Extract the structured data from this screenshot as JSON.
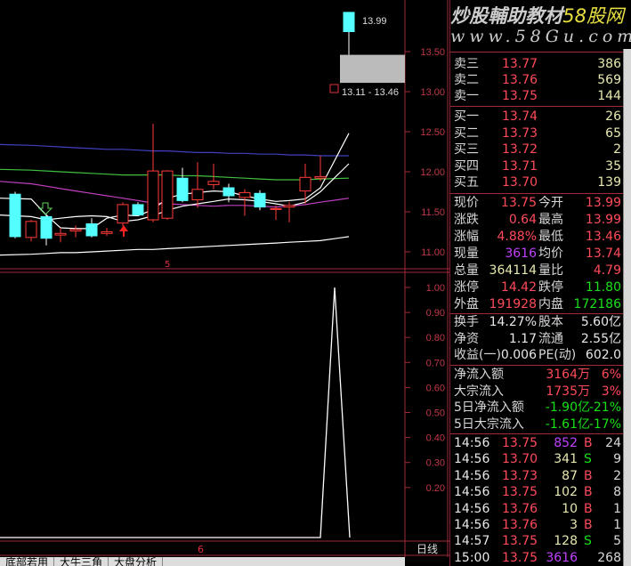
{
  "watermark": {
    "line1": "炒股輔助教材",
    "line1_brand": "58股网",
    "line2": "www.58Gu.com"
  },
  "main_chart": {
    "price_axis": [
      "13.50",
      "13.00",
      "12.50",
      "12.00",
      "11.50",
      "11.00"
    ],
    "price_axis_values": [
      13.5,
      13.0,
      12.5,
      12.0,
      11.5,
      11.0
    ],
    "last_price_label": "13.99",
    "range_label": "13.11 - 13.46",
    "range": [
      13.11,
      13.46
    ],
    "time_marker": "5",
    "colors": {
      "up": "#ff3a3a",
      "down": "#54ffff",
      "ma1": "#ffffff",
      "ma2": "#ffffff",
      "ma3": "#c040c0",
      "ma4": "#40c040",
      "ma5": "#4040c0",
      "ma6": "#ffffff"
    },
    "candles": [
      {
        "o": 11.72,
        "h": 11.75,
        "l": 11.17,
        "c": 11.19
      },
      {
        "o": 11.18,
        "h": 11.4,
        "l": 11.13,
        "c": 11.38
      },
      {
        "o": 11.44,
        "h": 11.48,
        "l": 11.08,
        "c": 11.17
      },
      {
        "o": 11.21,
        "h": 11.3,
        "l": 11.12,
        "c": 11.23
      },
      {
        "o": 11.26,
        "h": 11.33,
        "l": 11.18,
        "c": 11.28
      },
      {
        "o": 11.35,
        "h": 11.42,
        "l": 11.18,
        "c": 11.2
      },
      {
        "o": 11.23,
        "h": 11.3,
        "l": 11.2,
        "c": 11.25
      },
      {
        "o": 11.36,
        "h": 11.62,
        "l": 11.32,
        "c": 11.59
      },
      {
        "o": 11.59,
        "h": 11.62,
        "l": 11.45,
        "c": 11.46
      },
      {
        "o": 11.4,
        "h": 12.6,
        "l": 11.37,
        "c": 12.01
      },
      {
        "o": 11.42,
        "h": 12.02,
        "l": 11.4,
        "c": 12.01
      },
      {
        "o": 11.92,
        "h": 12.05,
        "l": 11.62,
        "c": 11.64
      },
      {
        "o": 11.65,
        "h": 12.12,
        "l": 11.55,
        "c": 11.78
      },
      {
        "o": 11.84,
        "h": 12.1,
        "l": 11.78,
        "c": 11.88
      },
      {
        "o": 11.8,
        "h": 11.85,
        "l": 11.62,
        "c": 11.7
      },
      {
        "o": 11.68,
        "h": 11.78,
        "l": 11.45,
        "c": 11.74
      },
      {
        "o": 11.73,
        "h": 11.77,
        "l": 11.52,
        "c": 11.56
      },
      {
        "o": 11.53,
        "h": 11.58,
        "l": 11.4,
        "c": 11.54
      },
      {
        "o": 11.56,
        "h": 11.62,
        "l": 11.37,
        "c": 11.58
      },
      {
        "o": 11.76,
        "h": 12.1,
        "l": 11.6,
        "c": 11.93
      },
      {
        "o": 11.92,
        "h": 12.2,
        "l": 11.88,
        "c": 11.94
      },
      {
        "o": 13.99,
        "h": 13.99,
        "l": 13.46,
        "c": 13.75
      }
    ],
    "ma_lines": [
      {
        "name": "ma5",
        "values": [
          12.34,
          12.33,
          12.32,
          12.31,
          12.3,
          12.29,
          12.28,
          12.28,
          12.27,
          12.26,
          12.26,
          12.25,
          12.24,
          12.24,
          12.23,
          12.23,
          12.22,
          12.22,
          12.21,
          12.21,
          12.2,
          12.2
        ]
      },
      {
        "name": "ma4",
        "values": [
          12.03,
          12.02,
          12.01,
          12.0,
          11.99,
          11.98,
          11.97,
          11.96,
          11.96,
          11.96,
          11.96,
          11.95,
          11.95,
          11.94,
          11.93,
          11.92,
          11.91,
          11.9,
          11.9,
          11.9,
          11.91,
          11.92
        ]
      },
      {
        "name": "ma3",
        "values": [
          11.88,
          11.85,
          11.82,
          11.79,
          11.76,
          11.73,
          11.7,
          11.67,
          11.64,
          11.61,
          11.6,
          11.59,
          11.58,
          11.57,
          11.58,
          11.58,
          11.57,
          11.56,
          11.57,
          11.59,
          11.62,
          11.67
        ]
      },
      {
        "name": "ma1",
        "values": [
          11.67,
          11.66,
          11.46,
          11.3,
          11.29,
          11.29,
          11.42,
          11.46,
          11.45,
          11.53,
          11.67,
          11.72,
          11.74,
          11.76,
          11.75,
          11.7,
          11.66,
          11.63,
          11.64,
          11.66,
          11.8,
          12.48
        ]
      },
      {
        "name": "ma2",
        "values": [
          11.46,
          11.44,
          11.4,
          11.42,
          11.44,
          11.45,
          11.44,
          11.38,
          11.4,
          11.45,
          11.52,
          11.57,
          11.6,
          11.63,
          11.66,
          11.65,
          11.63,
          11.6,
          11.57,
          11.62,
          11.75,
          12.1
        ]
      },
      {
        "name": "ma6",
        "values": [
          10.96,
          10.97,
          10.98,
          10.99,
          10.99,
          11.0,
          11.01,
          11.02,
          11.03,
          11.03,
          11.04,
          11.05,
          11.06,
          11.07,
          11.08,
          11.09,
          11.1,
          11.11,
          11.12,
          11.13,
          11.14,
          11.19
        ]
      }
    ]
  },
  "indicator": {
    "axis": [
      "1.00",
      "0.90",
      "0.80",
      "0.70",
      "0.60",
      "0.50",
      "0.40",
      "0.30",
      "0.20"
    ],
    "axis_values": [
      1.0,
      0.9,
      0.8,
      0.7,
      0.6,
      0.5,
      0.4,
      0.3,
      0.2
    ],
    "values": [
      0,
      0,
      0,
      0,
      0,
      0,
      0,
      0,
      0,
      0,
      0,
      0,
      0,
      0,
      0,
      0,
      0,
      0,
      0,
      0,
      0,
      1,
      0
    ],
    "time_marker": "6",
    "period_label": "日线"
  },
  "bottom_tabs": [
    "底部若用",
    "大牛三角",
    "大盘分析"
  ],
  "quote": {
    "sell": [
      {
        "label": "卖三",
        "price": "13.77",
        "vol": "386"
      },
      {
        "label": "卖二",
        "price": "13.76",
        "vol": "569"
      },
      {
        "label": "卖一",
        "price": "13.75",
        "vol": "144"
      }
    ],
    "buy": [
      {
        "label": "买一",
        "price": "13.74",
        "vol": "26"
      },
      {
        "label": "买二",
        "price": "13.73",
        "vol": "65"
      },
      {
        "label": "买三",
        "price": "13.72",
        "vol": "2"
      },
      {
        "label": "买四",
        "price": "13.71",
        "vol": "35"
      },
      {
        "label": "买五",
        "price": "13.70",
        "vol": "139"
      }
    ],
    "stats": [
      {
        "l1": "现价",
        "v1": "13.75",
        "c1": "red",
        "l2": "今开",
        "v2": "13.99",
        "c2": "red"
      },
      {
        "l1": "涨跌",
        "v1": "0.64",
        "c1": "red",
        "l2": "最高",
        "v2": "13.99",
        "c2": "red"
      },
      {
        "l1": "涨幅",
        "v1": "4.88%",
        "c1": "red",
        "l2": "最低",
        "v2": "13.46",
        "c2": "red"
      },
      {
        "l1": "现量",
        "v1": "3616",
        "c1": "pur",
        "l2": "均价",
        "v2": "13.74",
        "c2": "red"
      },
      {
        "l1": "总量",
        "v1": "364114",
        "c1": "yel",
        "l2": "量比",
        "v2": "4.79",
        "c2": "red"
      },
      {
        "l1": "涨停",
        "v1": "14.42",
        "c1": "red",
        "l2": "跌停",
        "v2": "11.80",
        "c2": "grn"
      },
      {
        "l1": "外盘",
        "v1": "191928",
        "c1": "red",
        "l2": "内盘",
        "v2": "172186",
        "c2": "grn"
      }
    ],
    "finance": [
      {
        "l1": "换手",
        "v1": "14.27%",
        "l2": "股本",
        "v2": "5.60亿"
      },
      {
        "l1": "净资",
        "v1": "1.17",
        "l2": "流通",
        "v2": "2.55亿"
      },
      {
        "l1": "收益(一)",
        "v1": "0.006",
        "l2": "PE(动)",
        "v2": "602.0"
      }
    ],
    "flow": [
      {
        "label": "净流入额",
        "value": "3164万",
        "pct": "6%",
        "c": "red"
      },
      {
        "label": "大宗流入",
        "value": "1735万",
        "pct": "3%",
        "c": "red"
      },
      {
        "label": "5日净流入额",
        "value": "-1.90亿",
        "pct": "-21%",
        "c": "grn"
      },
      {
        "label": "5日大宗流入",
        "value": "-1.61亿",
        "pct": "-17%",
        "c": "grn"
      }
    ],
    "ticks": [
      {
        "time": "14:56",
        "price": "13.75",
        "vol": "852",
        "bs": "B",
        "n": "24",
        "vc": "pur"
      },
      {
        "time": "14:56",
        "price": "13.70",
        "vol": "341",
        "bs": "S",
        "n": "9",
        "vc": "yel"
      },
      {
        "time": "14:56",
        "price": "13.73",
        "vol": "87",
        "bs": "B",
        "n": "2",
        "vc": "yel"
      },
      {
        "time": "14:56",
        "price": "13.75",
        "vol": "102",
        "bs": "B",
        "n": "8",
        "vc": "yel"
      },
      {
        "time": "14:56",
        "price": "13.76",
        "vol": "10",
        "bs": "B",
        "n": "1",
        "vc": "yel"
      },
      {
        "time": "14:56",
        "price": "13.76",
        "vol": "3",
        "bs": "B",
        "n": "1",
        "vc": "yel"
      },
      {
        "time": "14:57",
        "price": "13.75",
        "vol": "128",
        "bs": "S",
        "n": "5",
        "vc": "yel"
      },
      {
        "time": "15:00",
        "price": "13.75",
        "vol": "3616",
        "bs": "",
        "n": "268",
        "vc": "pur"
      }
    ]
  }
}
